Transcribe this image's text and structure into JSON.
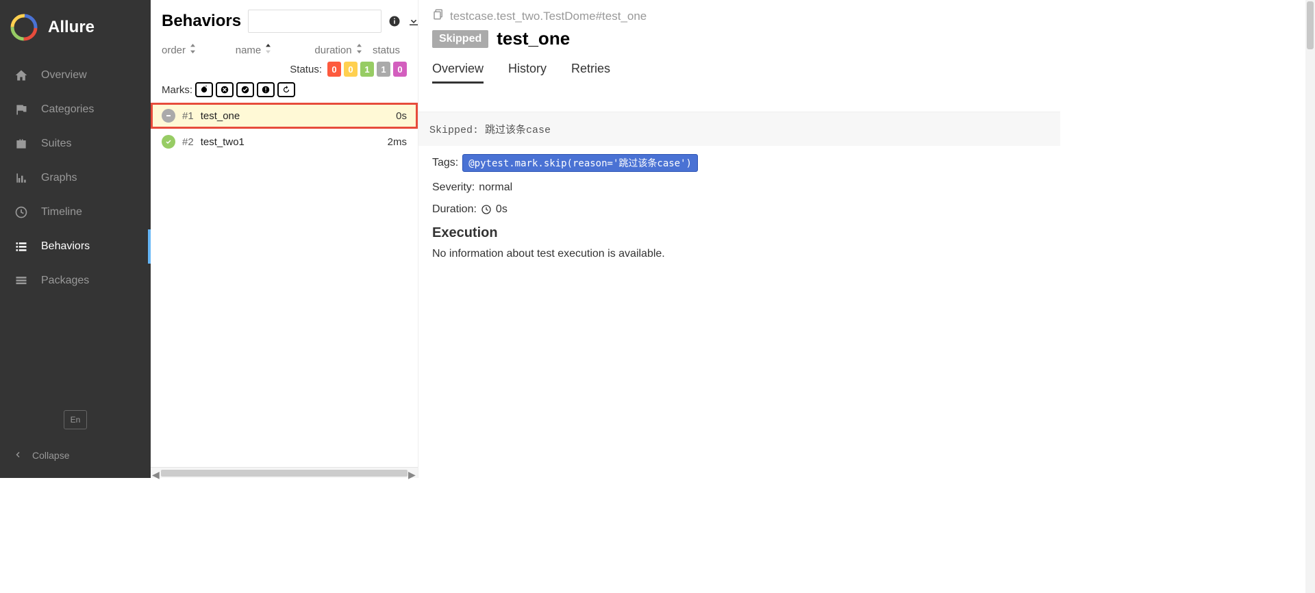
{
  "brand": "Allure",
  "sidebar": {
    "items": [
      {
        "label": "Overview"
      },
      {
        "label": "Categories"
      },
      {
        "label": "Suites"
      },
      {
        "label": "Graphs"
      },
      {
        "label": "Timeline"
      },
      {
        "label": "Behaviors"
      },
      {
        "label": "Packages"
      }
    ],
    "lang": "En",
    "collapse": "Collapse"
  },
  "middle": {
    "title": "Behaviors",
    "columns": {
      "order": "order",
      "name": "name",
      "duration": "duration",
      "status": "status"
    },
    "status_label": "Status:",
    "marks_label": "Marks:",
    "status_counts": {
      "failed": "0",
      "broken": "0",
      "passed": "1",
      "skipped": "1",
      "unknown": "0"
    },
    "tests": [
      {
        "num": "#1",
        "name": "test_one",
        "duration": "0s",
        "status": "skipped",
        "selected": true
      },
      {
        "num": "#2",
        "name": "test_two1",
        "duration": "2ms",
        "status": "passed",
        "selected": false
      }
    ]
  },
  "right": {
    "path": "testcase.test_two.TestDome#test_one",
    "status": "Skipped",
    "title": "test_one",
    "tabs": [
      {
        "label": "Overview",
        "active": true
      },
      {
        "label": "History",
        "active": false
      },
      {
        "label": "Retries",
        "active": false
      }
    ],
    "skip_message": "Skipped: 跳过该条case",
    "tags_label": "Tags:",
    "tag_value": "@pytest.mark.skip(reason='跳过该条case')",
    "severity_label": "Severity:",
    "severity_value": "normal",
    "duration_label": "Duration:",
    "duration_value": "0s",
    "execution_heading": "Execution",
    "execution_msg": "No information about test execution is available."
  }
}
